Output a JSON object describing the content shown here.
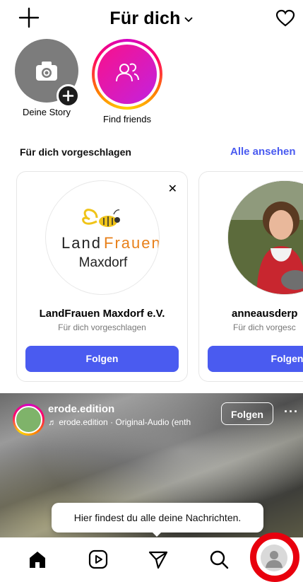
{
  "header": {
    "title": "Für dich",
    "icons": {
      "left": "plus-icon",
      "title": "chevron-down-icon",
      "right": "heart-icon"
    }
  },
  "stories": [
    {
      "label": "Deine Story",
      "icon": "camera-icon"
    },
    {
      "label": "Find friends",
      "icon": "people-icon"
    }
  ],
  "suggestions": {
    "title": "Für dich vorgeschlagen",
    "see_all": "Alle ansehen",
    "cards": [
      {
        "name": "LandFrauen Maxdorf e.V.",
        "subtitle": "Für dich vorgeschlagen",
        "button": "Folgen",
        "logo": {
          "land": "Land",
          "frauen": "Frauen",
          "place": "Maxdorf"
        }
      },
      {
        "name": "anneausderp",
        "subtitle": "Für dich vorgesc",
        "button": "Folgen"
      }
    ]
  },
  "reel": {
    "username": "erode.edition",
    "audio": "erode.edition · Original-Audio (enth",
    "follow": "Folgen",
    "more": "···"
  },
  "tooltip": "Hier findest du alle deine Nachrichten.",
  "nav": [
    "home-icon",
    "reels-icon",
    "send-icon",
    "search-icon",
    "profile-icon"
  ],
  "colors": {
    "accent": "#4a5bf0",
    "highlight_ring": "#e8000d"
  }
}
